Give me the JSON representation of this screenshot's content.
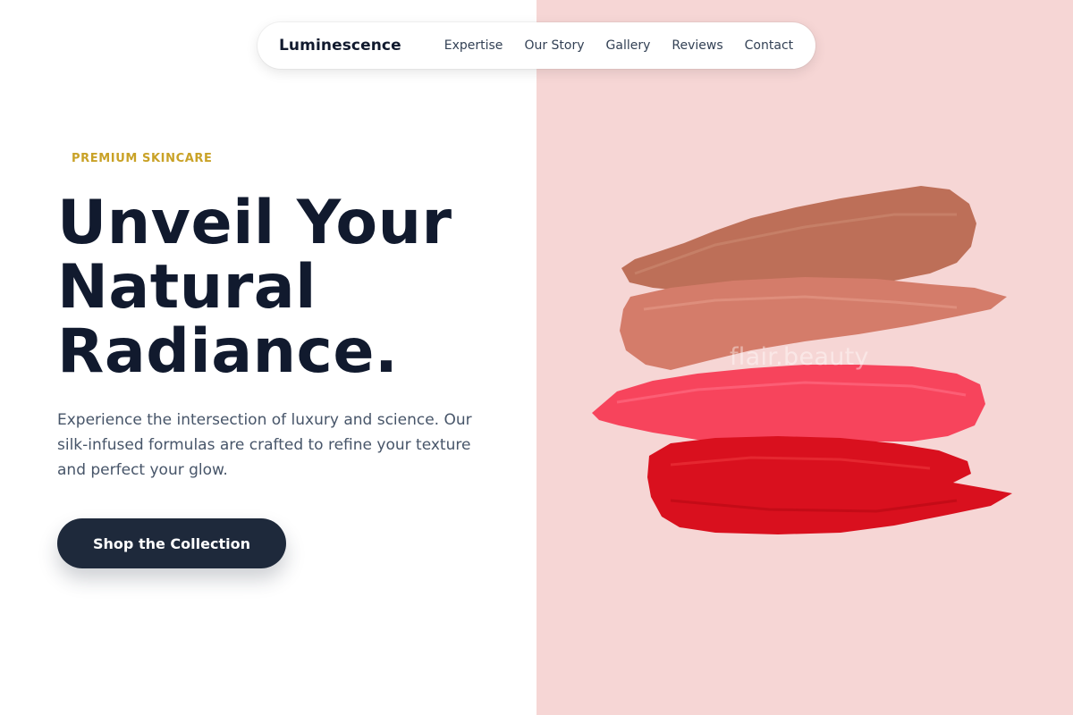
{
  "brand": {
    "name": "Luminescence"
  },
  "nav": {
    "links": [
      "Expertise",
      "Our Story",
      "Gallery",
      "Reviews",
      "Contact"
    ]
  },
  "hero": {
    "eyebrow": "PREMIUM SKINCARE",
    "headline": [
      "Unveil Your",
      "Natural",
      "Radiance."
    ],
    "description": "Experience the intersection of luxury and science. Our silk-infused formulas are crafted to refine your texture and perfect your glow.",
    "cta_label": "Shop the Collection"
  },
  "image": {
    "watermark": "flair.beauty",
    "background_color": "#f6d6d5",
    "swatch_colors": [
      "#bd6f58",
      "#d47c6a",
      "#f7445c",
      "#d9101e"
    ]
  },
  "colors": {
    "accent": "#c9a227",
    "heading": "#111a2e",
    "body_text": "#475569",
    "button": "#1e293b"
  }
}
